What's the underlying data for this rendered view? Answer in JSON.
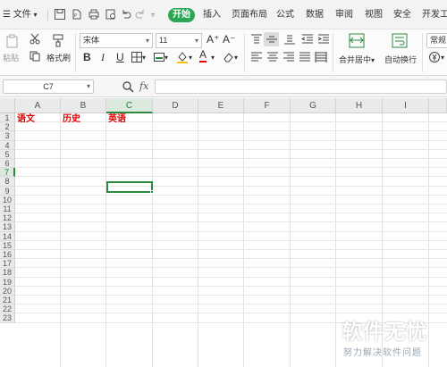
{
  "menubar": {
    "file": "文件",
    "start": "开始",
    "tabs": [
      "插入",
      "页面布局",
      "公式",
      "数据",
      "审阅",
      "视图",
      "安全",
      "开发工"
    ]
  },
  "ribbon": {
    "paste": "粘贴",
    "format_painter": "格式刷",
    "font_name": "宋体",
    "font_size": "11",
    "merge_center": "合并居中",
    "wrap_text": "自动换行",
    "number_format": "常规",
    "bold": "B",
    "italic": "I",
    "underline": "U"
  },
  "formula_bar": {
    "name_box": "C7",
    "fx": "fx",
    "formula": ""
  },
  "sheet": {
    "columns": [
      "A",
      "B",
      "C",
      "D",
      "E",
      "F",
      "G",
      "H",
      "I"
    ],
    "rows": [
      "1",
      "2",
      "3",
      "4",
      "5",
      "6",
      "7",
      "8",
      "9",
      "10",
      "11",
      "12",
      "13",
      "14",
      "15",
      "16",
      "17",
      "18",
      "19",
      "20",
      "21",
      "22",
      "23"
    ],
    "active_column": "C",
    "active_row": "7",
    "cells": {
      "A1": "语文",
      "B1": "历史",
      "C1": "英语"
    },
    "text_color": "#e00000",
    "accent_color": "#2b8a3e"
  },
  "watermark": {
    "title": "软件无忧",
    "subtitle": "努力解决软件问题"
  }
}
